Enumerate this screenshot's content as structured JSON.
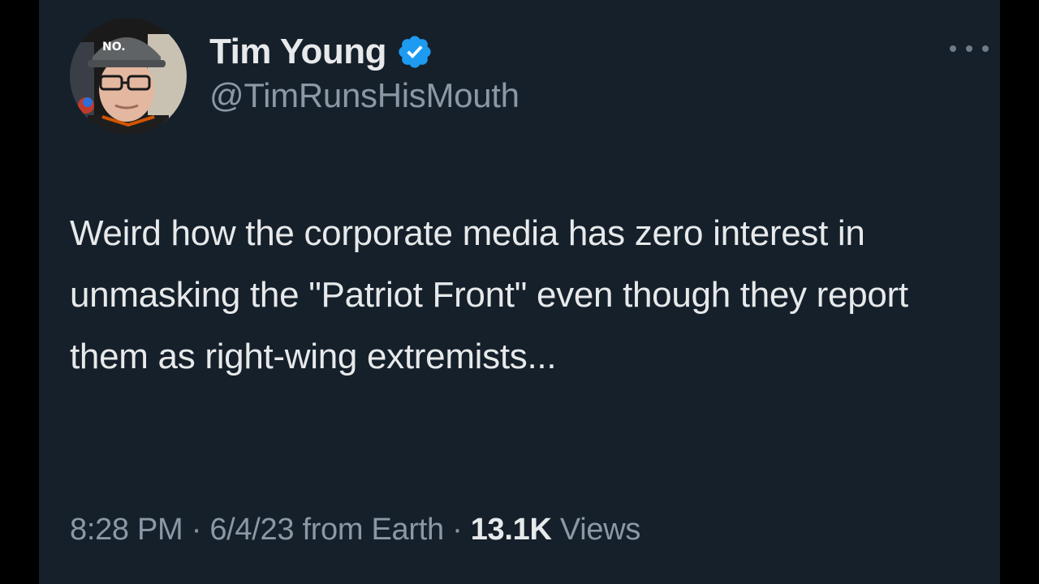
{
  "tweet": {
    "author": {
      "display_name": "Tim Young",
      "handle": "@TimRunsHisMouth",
      "verified": true,
      "avatar_hat_text": "NO."
    },
    "text": "Weird how the corporate media has zero interest in unmasking the \"Patriot Front\" even though they report them as right-wing extremists...",
    "time": "8:28 PM",
    "separator": "·",
    "date": "6/4/23",
    "source": "from Earth",
    "views_count": "13.1K",
    "views_label": "Views"
  },
  "icons": {
    "verified": "verified-badge-icon",
    "more": "more-options-icon"
  },
  "colors": {
    "background": "#15202b",
    "primary_text": "#e7e9ea",
    "secondary_text": "#8b98a5",
    "verified_blue": "#1d9bf0"
  }
}
